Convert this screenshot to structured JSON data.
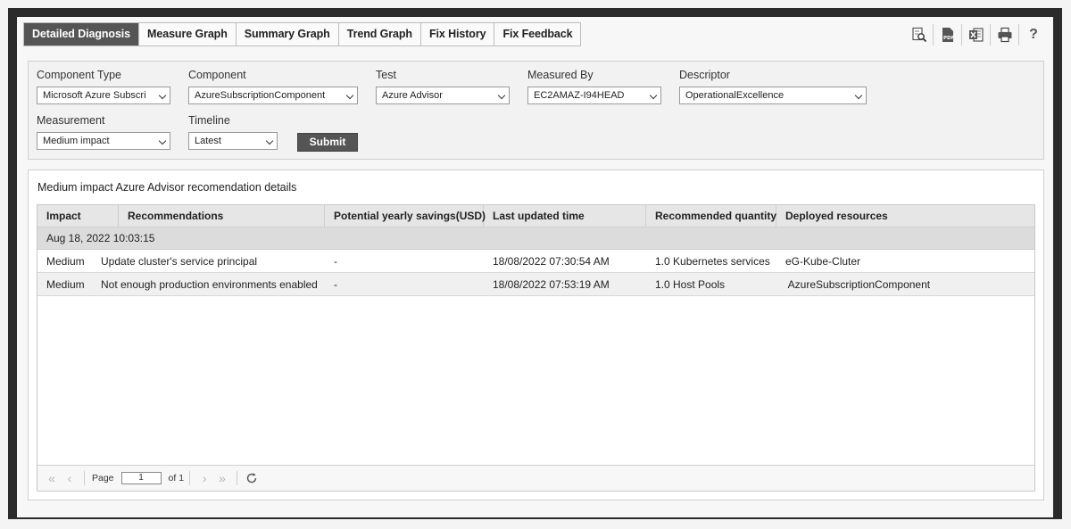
{
  "tabs": [
    {
      "label": "Detailed Diagnosis",
      "active": true
    },
    {
      "label": "Measure Graph"
    },
    {
      "label": "Summary Graph"
    },
    {
      "label": "Trend Graph"
    },
    {
      "label": "Fix History"
    },
    {
      "label": "Fix Feedback"
    }
  ],
  "toolbar": {
    "icons": [
      "search-document-icon",
      "pdf-icon",
      "excel-icon",
      "print-icon",
      "help-icon"
    ],
    "help_glyph": "?"
  },
  "filters": {
    "component_type": {
      "label": "Component Type",
      "value": "Microsoft Azure Subscri"
    },
    "component": {
      "label": "Component",
      "value": "AzureSubscriptionComponent"
    },
    "test": {
      "label": "Test",
      "value": "Azure Advisor"
    },
    "measured_by": {
      "label": "Measured By",
      "value": "EC2AMAZ-I94HEAD"
    },
    "descriptor": {
      "label": "Descriptor",
      "value": "OperationalExcellence"
    },
    "measurement": {
      "label": "Measurement",
      "value": "Medium impact"
    },
    "timeline": {
      "label": "Timeline",
      "value": "Latest"
    },
    "submit_label": "Submit"
  },
  "results": {
    "title": "Medium impact Azure Advisor recomendation details",
    "columns": [
      "Impact",
      "Recommendations",
      "Potential yearly savings(USD)",
      "Last updated time",
      "Recommended quantity",
      "Deployed resources"
    ],
    "group": "Aug 18, 2022 10:03:15",
    "rows": [
      {
        "impact": "Medium",
        "recommendation": "Update cluster's service principal",
        "savings": "-",
        "updated": "18/08/2022 07:30:54 AM",
        "quantity": "1.0 Kubernetes services",
        "resources": "eG-Kube-Cluter"
      },
      {
        "impact": "Medium",
        "recommendation": "Not enough production environments enabled",
        "savings": "-",
        "updated": "18/08/2022 07:53:19 AM",
        "quantity": "1.0 Host Pools",
        "resources": " AzureSubscriptionComponent"
      }
    ]
  },
  "pager": {
    "page_label": "Page",
    "page_value": "1",
    "of_label": "of 1"
  },
  "colors": {
    "active_tab": "#555555",
    "frame": "#2b2b2b",
    "header_bg": "#e6e6e6",
    "group_bg": "#dcdcdc"
  }
}
